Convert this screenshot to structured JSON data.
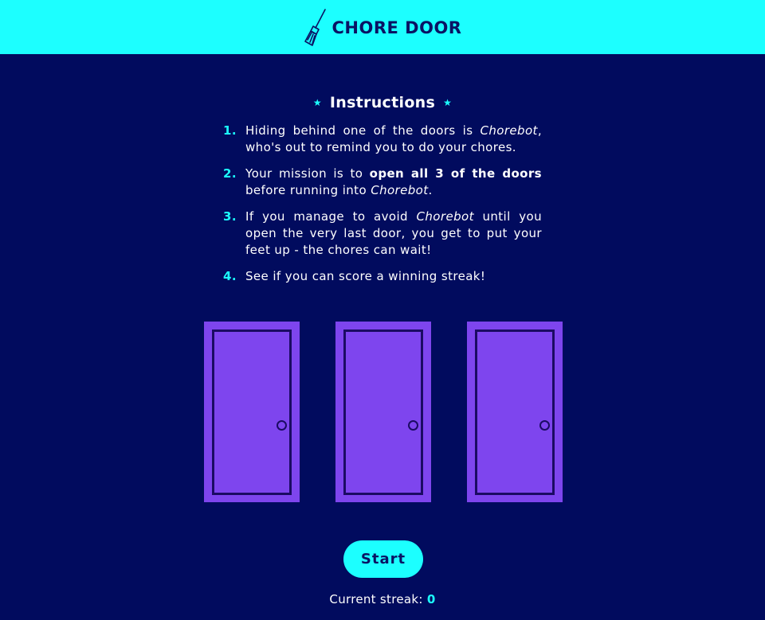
{
  "header": {
    "title": "CHORE DOOR",
    "logo_icon": "broom-icon"
  },
  "instructions": {
    "title": "Instructions",
    "star_glyph": "★",
    "items": [
      {
        "number": "1.",
        "parts": [
          {
            "text": "Hiding behind one of the doors is ",
            "style": "normal"
          },
          {
            "text": "Chorebot",
            "style": "italic"
          },
          {
            "text": ", who's out to remind you to do your chores.",
            "style": "normal"
          }
        ]
      },
      {
        "number": "2.",
        "parts": [
          {
            "text": "Your mission is to ",
            "style": "normal"
          },
          {
            "text": "open all 3 of the doors",
            "style": "bold"
          },
          {
            "text": " before running into ",
            "style": "normal"
          },
          {
            "text": "Chorebot",
            "style": "italic"
          },
          {
            "text": ".",
            "style": "normal"
          }
        ]
      },
      {
        "number": "3.",
        "parts": [
          {
            "text": "If you manage to avoid ",
            "style": "normal"
          },
          {
            "text": "Chorebot",
            "style": "italic"
          },
          {
            "text": " until you open the very last door, you get to put your feet up - the chores can wait!",
            "style": "normal"
          }
        ]
      },
      {
        "number": "4.",
        "parts": [
          {
            "text": "See if you can score a winning streak!",
            "style": "normal"
          }
        ]
      }
    ]
  },
  "doors": [
    {
      "id": "door-1",
      "state": "closed"
    },
    {
      "id": "door-2",
      "state": "closed"
    },
    {
      "id": "door-3",
      "state": "closed"
    }
  ],
  "controls": {
    "start_label": "Start"
  },
  "streak": {
    "label": "Current streak:",
    "value": "0"
  },
  "colors": {
    "background": "#010B5E",
    "header": "#1CFFFF",
    "accent": "#1CFFFF",
    "door": "#7E45EE",
    "door_outline": "#1B0B63",
    "title_text": "#0A1363"
  }
}
